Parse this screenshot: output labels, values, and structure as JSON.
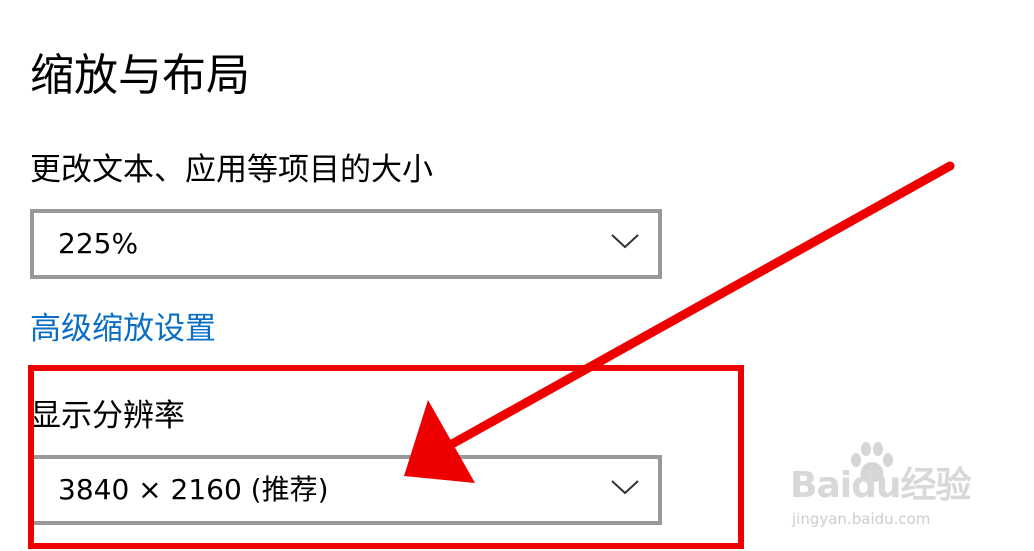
{
  "scale_layout": {
    "title": "缩放与布局",
    "scale_label": "更改文本、应用等项目的大小",
    "scale_value": "225%",
    "advanced_link": "高级缩放设置",
    "resolution_label": "显示分辨率",
    "resolution_value": "3840 × 2160 (推荐)"
  },
  "annotation": {
    "color": "#ee0000",
    "highlight_target": "显示分辨率"
  },
  "watermark": {
    "brand": "Baidu经验",
    "url": "jingyan.baidu.com"
  },
  "colors": {
    "link": "#0a6fc4",
    "dropdown_border": "#999999",
    "annotation_red": "#ee0000"
  },
  "icons": {
    "dropdown": "chevron-down-icon",
    "arrow": "annotation-arrow-icon",
    "watermark": "baidu-paw-icon"
  }
}
